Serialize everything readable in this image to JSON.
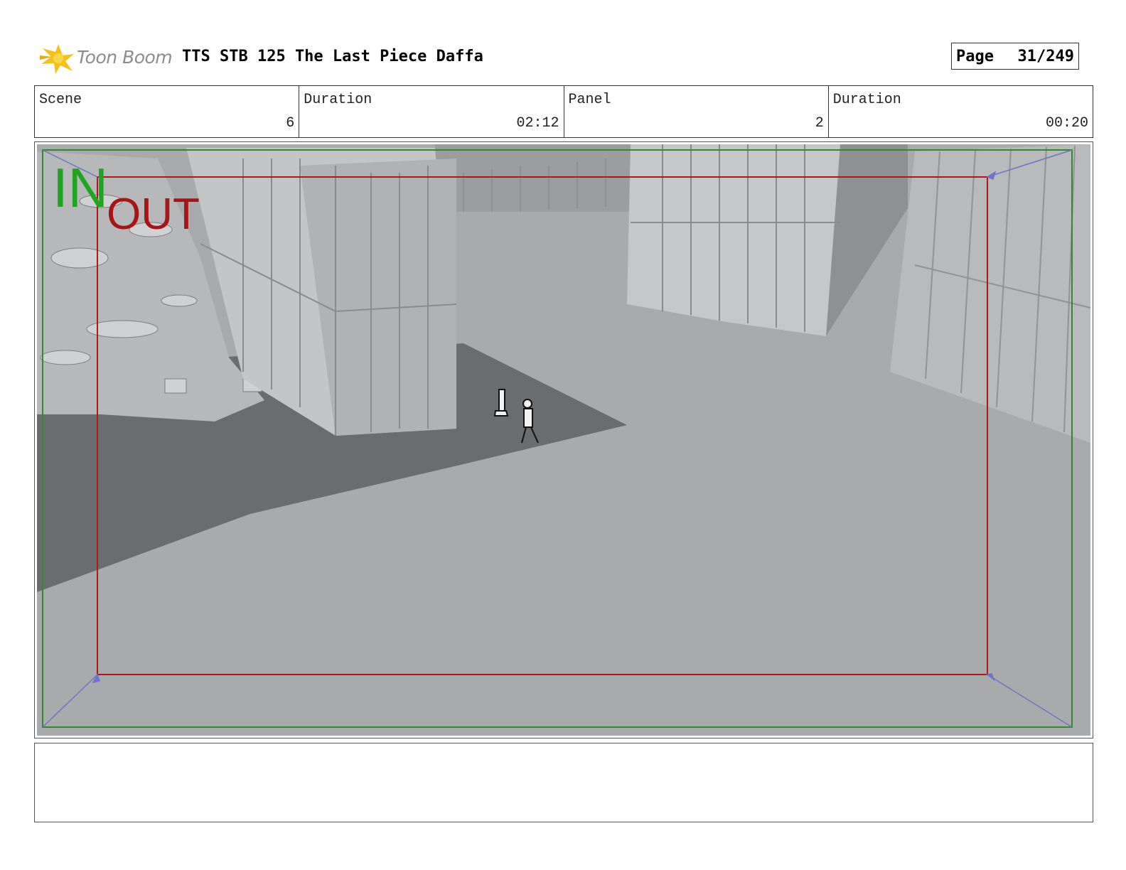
{
  "header": {
    "logo_text": "Toon Boom",
    "title": "TTS STB 125 The Last Piece Daffa",
    "page_label": "Page",
    "page_value": "31/249"
  },
  "info": {
    "scene_label": "Scene",
    "scene_value": "6",
    "scene_duration_label": "Duration",
    "scene_duration_value": "02:12",
    "panel_label": "Panel",
    "panel_value": "2",
    "panel_duration_label": "Duration",
    "panel_duration_value": "00:20"
  },
  "panel": {
    "in_label": "IN",
    "out_label": "OUT",
    "colors": {
      "in_frame": "#2e8b2e",
      "out_frame": "#b01818",
      "camera_arrows": "#6f74c8",
      "background": "#a7a8aa"
    }
  },
  "caption": {
    "text": ""
  }
}
